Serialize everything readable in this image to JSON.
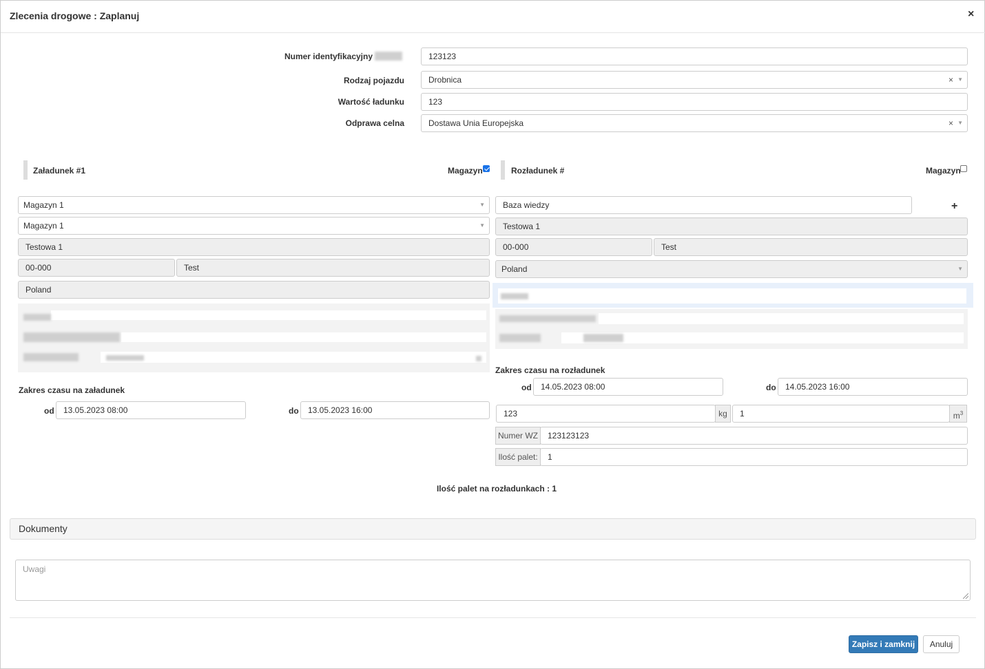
{
  "dialog": {
    "title": "Zlecenia drogowe : Zaplanuj",
    "close_label": "×"
  },
  "form": {
    "id_label": "Numer identyfikacyjny",
    "id_value": "123123",
    "vehicle_label": "Rodzaj pojazdu",
    "vehicle_value": "Drobnica",
    "cargo_value_label": "Wartość ładunku",
    "cargo_value": "123",
    "customs_label": "Odprawa celna",
    "customs_value": "Dostawa Unia Europejska",
    "clear_symbol": "×"
  },
  "loading": {
    "title": "Załadunek #1",
    "warehouse_label": "Magazyn",
    "warehouse_checked": true,
    "select1": "Magazyn 1",
    "select2": "Magazyn 1",
    "street": "Testowa 1",
    "postcode": "00-000",
    "city": "Test",
    "country": "Poland",
    "time_title": "Zakres czasu na załadunek",
    "from_label": "od",
    "from_value": "13.05.2023 08:00",
    "to_label": "do",
    "to_value": "13.05.2023 16:00"
  },
  "unloading": {
    "title": "Rozładunek #",
    "warehouse_label": "Magazyn",
    "warehouse_checked": false,
    "name": "Baza wiedzy",
    "add_symbol": "+",
    "street": "Testowa 1",
    "postcode": "00-000",
    "city": "Test",
    "country": "Poland",
    "time_title": "Zakres czasu na rozładunek",
    "from_label": "od",
    "from_value": "14.05.2023 08:00",
    "to_label": "do",
    "to_value": "14.05.2023 16:00",
    "weight": "123",
    "weight_unit": "kg",
    "volume": "1",
    "volume_unit": "m",
    "volume_unit_sup": "3",
    "wz_label": "Numer WZ",
    "wz_value": "123123123",
    "pallets_label": "Ilość palet:",
    "pallets_value": "1"
  },
  "summary": "Ilość palet na rozładunkach : 1",
  "documents_title": "Dokumenty",
  "notes_placeholder": "Uwagi",
  "buttons": {
    "save": "Zapisz i zamknij",
    "cancel": "Anuluj"
  },
  "colors": {
    "primary": "#337ab7",
    "readonly_bg": "#eeeeee",
    "border": "#cccccc"
  }
}
